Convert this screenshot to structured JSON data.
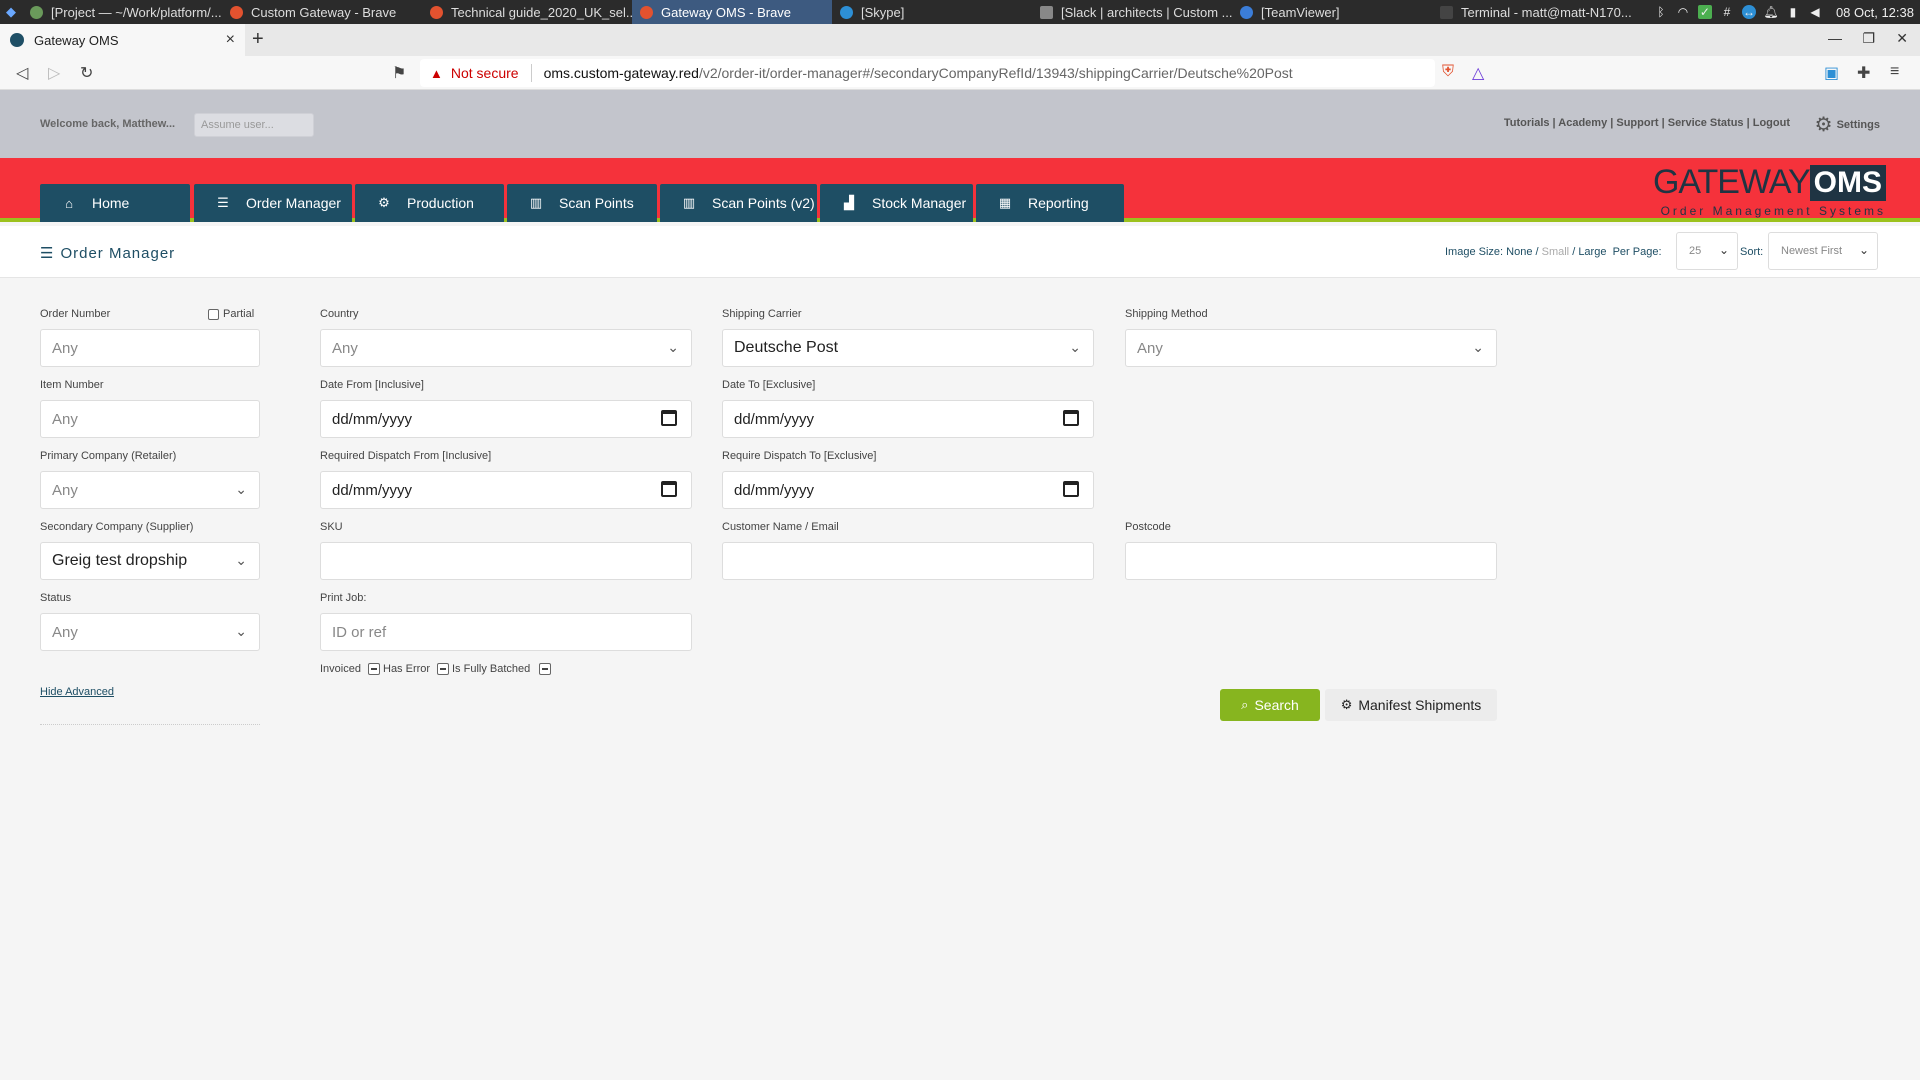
{
  "taskbar": {
    "tasks": [
      {
        "label": "[Project — ~/Work/platform/...",
        "color": "#6a9a5b",
        "active": false
      },
      {
        "label": "Custom Gateway - Brave",
        "color": "#e2522f",
        "active": false
      },
      {
        "label": "Technical guide_2020_UK_sel...",
        "color": "#e2522f",
        "active": false
      },
      {
        "label": "Gateway OMS - Brave",
        "color": "#e2522f",
        "active": true
      },
      {
        "label": "[Skype]",
        "color": "#2d8fd5",
        "active": false
      },
      {
        "label": "[Slack | architects | Custom ...",
        "color": "#888888",
        "active": false
      },
      {
        "label": "[TeamViewer]",
        "color": "#3b7dd8",
        "active": false
      },
      {
        "label": "Terminal - matt@matt-N170...",
        "color": "#444444",
        "active": false
      }
    ],
    "clock": "08 Oct, 12:38"
  },
  "browser": {
    "tab_title": "Gateway OMS",
    "not_secure": "Not secure",
    "url_host": "oms.custom-gateway.red",
    "url_path": "/v2/order-it/order-manager#/secondaryCompanyRefId/13943/shippingCarrier/Deutsche%20Post"
  },
  "header": {
    "welcome": "Welcome back, Matthew...",
    "assume_placeholder": "Assume user...",
    "links": "Tutorials | Academy | Support | Service Status | Logout",
    "settings": "Settings"
  },
  "nav": {
    "tabs": [
      {
        "label": "Home",
        "icon": "home-icon"
      },
      {
        "label": "Order Manager",
        "icon": "list-icon"
      },
      {
        "label": "Production",
        "icon": "cogs-icon"
      },
      {
        "label": "Scan Points",
        "icon": "barcode-icon"
      },
      {
        "label": "Scan Points (v2)",
        "icon": "barcode-icon"
      },
      {
        "label": "Stock Manager",
        "icon": "chart-icon"
      },
      {
        "label": "Reporting",
        "icon": "table-icon"
      }
    ],
    "logo_gateway": "GATEWAY",
    "logo_oms": "OMS",
    "logo_sub": "Order Management Systems"
  },
  "subheader": {
    "title": "Order Manager",
    "image_size_label": "Image Size:",
    "image_none": "None",
    "image_small": "Small",
    "image_large": "Large",
    "per_page_label": "Per Page:",
    "per_page_value": "25",
    "sort_label": "Sort:",
    "sort_value": "Newest First"
  },
  "form": {
    "order_number_label": "Order Number",
    "order_number_placeholder": "Any",
    "partial_label": "Partial",
    "country_label": "Country",
    "country_value": "Any",
    "shipping_carrier_label": "Shipping Carrier",
    "shipping_carrier_value": "Deutsche Post",
    "shipping_method_label": "Shipping Method",
    "shipping_method_value": "Any",
    "item_number_label": "Item Number",
    "item_number_placeholder": "Any",
    "date_from_label": "Date From [Inclusive]",
    "date_to_label": "Date To [Exclusive]",
    "date_placeholder": "dd/mm/yyyy",
    "primary_company_label": "Primary Company (Retailer)",
    "primary_company_value": "Any",
    "req_dispatch_from_label": "Required Dispatch From [Inclusive]",
    "req_dispatch_to_label": "Require Dispatch To [Exclusive]",
    "secondary_company_label": "Secondary Company (Supplier)",
    "secondary_company_value": "Greig test dropship",
    "sku_label": "SKU",
    "customer_label": "Customer Name / Email",
    "postcode_label": "Postcode",
    "status_label": "Status",
    "status_value": "Any",
    "print_job_label": "Print Job:",
    "print_job_placeholder": "ID or ref",
    "invoiced_label": "Invoiced",
    "has_error_label": "Has Error",
    "fully_batched_label": "Is Fully Batched",
    "hide_advanced": "Hide Advanced",
    "search_button": "Search",
    "manifest_button": "Manifest Shipments"
  },
  "colors": {
    "nav_bg": "#1e4e64",
    "band_red": "#f5323b",
    "band_green": "#9cc11d",
    "search_green": "#87b51f"
  }
}
